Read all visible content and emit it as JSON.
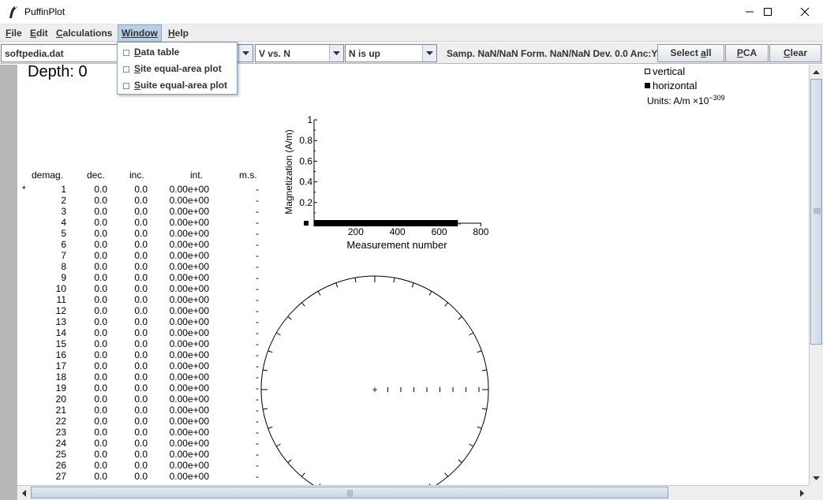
{
  "window": {
    "title": "PuffinPlot",
    "icon": "puffin-icon"
  },
  "menubar": {
    "file": {
      "mn": "F",
      "rest": "ile"
    },
    "edit": {
      "mn": "E",
      "rest": "dit"
    },
    "calculations": {
      "mn": "C",
      "rest": "alculations"
    },
    "window": {
      "mn": "W",
      "rest": "indow"
    },
    "help": {
      "mn": "H",
      "rest": "elp"
    }
  },
  "window_menu": [
    {
      "mn": "D",
      "rest": "ata table",
      "checked": false
    },
    {
      "mn": "S",
      "rest": "ite equal-area plot",
      "checked": false
    },
    {
      "mn": "S",
      "rest": "uite equal-area plot",
      "checked": false
    }
  ],
  "toolbar": {
    "file_combo": "softpedia.dat",
    "projection_combo": "V vs. N",
    "orientation_combo": "N is up",
    "sample_info": "Samp. NaN/NaN Form. NaN/NaN Dev. 0.0 Anc:Y",
    "select_all": {
      "mn": "Select ",
      "u": "a",
      "rest": "ll"
    },
    "pca": {
      "u": "P",
      "rest": "CA"
    },
    "clear": {
      "u": "C",
      "rest": "lear"
    }
  },
  "plot": {
    "depth": "Depth: 0",
    "legend": {
      "vertical": "vertical",
      "horizontal": "horizontal"
    },
    "units_prefix": "Units:  A/m ×10",
    "units_exponent": "−309"
  },
  "table": {
    "headers": {
      "demag": "demag.",
      "dec": "dec.",
      "inc": "inc.",
      "int": "int.",
      "ms": "m.s."
    },
    "selected_marker": "*",
    "rows": [
      {
        "n": "1",
        "dec": "0.0",
        "inc": "0.0",
        "int": "0.00e+00",
        "ms": "-"
      },
      {
        "n": "2",
        "dec": "0.0",
        "inc": "0.0",
        "int": "0.00e+00",
        "ms": "-"
      },
      {
        "n": "3",
        "dec": "0.0",
        "inc": "0.0",
        "int": "0.00e+00",
        "ms": "-"
      },
      {
        "n": "4",
        "dec": "0.0",
        "inc": "0.0",
        "int": "0.00e+00",
        "ms": "-"
      },
      {
        "n": "5",
        "dec": "0.0",
        "inc": "0.0",
        "int": "0.00e+00",
        "ms": "-"
      },
      {
        "n": "6",
        "dec": "0.0",
        "inc": "0.0",
        "int": "0.00e+00",
        "ms": "-"
      },
      {
        "n": "7",
        "dec": "0.0",
        "inc": "0.0",
        "int": "0.00e+00",
        "ms": "-"
      },
      {
        "n": "8",
        "dec": "0.0",
        "inc": "0.0",
        "int": "0.00e+00",
        "ms": "-"
      },
      {
        "n": "9",
        "dec": "0.0",
        "inc": "0.0",
        "int": "0.00e+00",
        "ms": "-"
      },
      {
        "n": "10",
        "dec": "0.0",
        "inc": "0.0",
        "int": "0.00e+00",
        "ms": "-"
      },
      {
        "n": "11",
        "dec": "0.0",
        "inc": "0.0",
        "int": "0.00e+00",
        "ms": "-"
      },
      {
        "n": "12",
        "dec": "0.0",
        "inc": "0.0",
        "int": "0.00e+00",
        "ms": "-"
      },
      {
        "n": "13",
        "dec": "0.0",
        "inc": "0.0",
        "int": "0.00e+00",
        "ms": "-"
      },
      {
        "n": "14",
        "dec": "0.0",
        "inc": "0.0",
        "int": "0.00e+00",
        "ms": "-"
      },
      {
        "n": "15",
        "dec": "0.0",
        "inc": "0.0",
        "int": "0.00e+00",
        "ms": "-"
      },
      {
        "n": "16",
        "dec": "0.0",
        "inc": "0.0",
        "int": "0.00e+00",
        "ms": "-"
      },
      {
        "n": "17",
        "dec": "0.0",
        "inc": "0.0",
        "int": "0.00e+00",
        "ms": "-"
      },
      {
        "n": "18",
        "dec": "0.0",
        "inc": "0.0",
        "int": "0.00e+00",
        "ms": "-"
      },
      {
        "n": "19",
        "dec": "0.0",
        "inc": "0.0",
        "int": "0.00e+00",
        "ms": "-"
      },
      {
        "n": "20",
        "dec": "0.0",
        "inc": "0.0",
        "int": "0.00e+00",
        "ms": "-"
      },
      {
        "n": "21",
        "dec": "0.0",
        "inc": "0.0",
        "int": "0.00e+00",
        "ms": "-"
      },
      {
        "n": "22",
        "dec": "0.0",
        "inc": "0.0",
        "int": "0.00e+00",
        "ms": "-"
      },
      {
        "n": "23",
        "dec": "0.0",
        "inc": "0.0",
        "int": "0.00e+00",
        "ms": "-"
      },
      {
        "n": "24",
        "dec": "0.0",
        "inc": "0.0",
        "int": "0.00e+00",
        "ms": "-"
      },
      {
        "n": "25",
        "dec": "0.0",
        "inc": "0.0",
        "int": "0.00e+00",
        "ms": "-"
      },
      {
        "n": "26",
        "dec": "0.0",
        "inc": "0.0",
        "int": "0.00e+00",
        "ms": "-"
      },
      {
        "n": "27",
        "dec": "0.0",
        "inc": "0.0",
        "int": "0.00e+00",
        "ms": "-"
      }
    ]
  },
  "intensity_plot": {
    "ylabel": "Magnetization (A/m)",
    "xlabel": "Measurement number",
    "y_ticks": [
      "0.2",
      "0.4",
      "0.6",
      "0.8",
      "1"
    ],
    "x_ticks": [
      "200",
      "400",
      "600",
      "800"
    ],
    "points_range": [
      1,
      690
    ]
  },
  "equal_area": {
    "marker": "+"
  },
  "icons": {
    "minimize": "minimize-icon",
    "maximize": "maximize-icon",
    "close": "close-icon",
    "combo_arrow": "chevron-down-icon",
    "scroll_up": "arrow-up-icon",
    "scroll_down": "arrow-down-icon",
    "scroll_left": "arrow-left-icon",
    "scroll_right": "arrow-right-icon"
  },
  "colors": {
    "menu_active": "#b8cfe5",
    "button_border": "#8a99a8",
    "scroll_thumb": "#c8d6e4"
  }
}
